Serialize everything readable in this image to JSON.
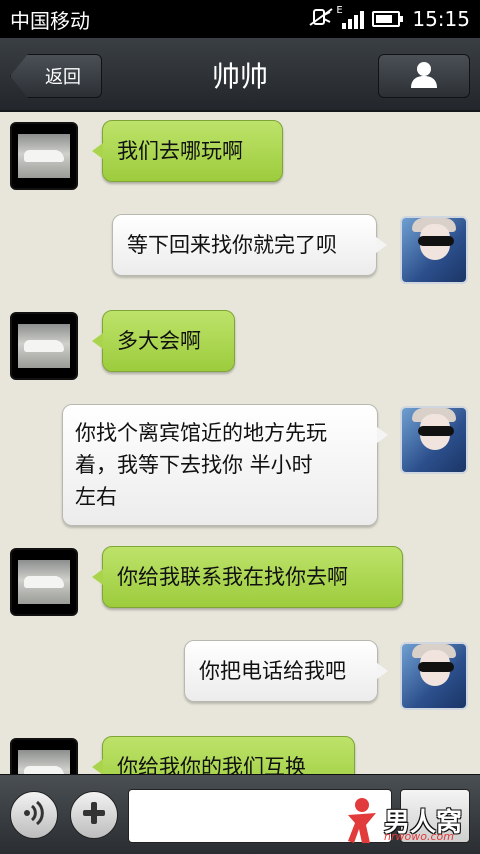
{
  "status_bar": {
    "carrier": "中国移动",
    "network_type": "E",
    "time": "15:15",
    "battery_level": 0.8,
    "icons": [
      "mute-icon",
      "signal-icon",
      "battery-icon"
    ]
  },
  "title_bar": {
    "back_label": "返回",
    "title": "帅帅",
    "profile_icon": "person-icon"
  },
  "messages": [
    {
      "side": "in",
      "sender": "contact",
      "text": "我们去哪玩啊"
    },
    {
      "side": "out",
      "sender": "me",
      "text": "等下回来找你就完了呗"
    },
    {
      "side": "in",
      "sender": "contact",
      "text": "多大会啊"
    },
    {
      "side": "out",
      "sender": "me",
      "lines": [
        "你找个离宾馆近的地方先玩",
        "着，我等下去找你  半小时",
        "左右"
      ]
    },
    {
      "side": "in",
      "sender": "contact",
      "text": "你给我联系我在找你去啊"
    },
    {
      "side": "out",
      "sender": "me",
      "text": "你把电话给我吧"
    },
    {
      "side": "in",
      "sender": "contact",
      "text": "你给我你的我们互换"
    }
  ],
  "input_bar": {
    "voice_icon": "voice-icon",
    "add_icon": "plus-icon",
    "text_value": ""
  },
  "watermark": {
    "logo": "男人窝",
    "domain": "nrwowo.com"
  },
  "colors": {
    "incoming_bubble": "#a9d44b",
    "outgoing_bubble": "#f4f4f4",
    "background": "#e8e6da",
    "title_bar": "#2c3035"
  }
}
